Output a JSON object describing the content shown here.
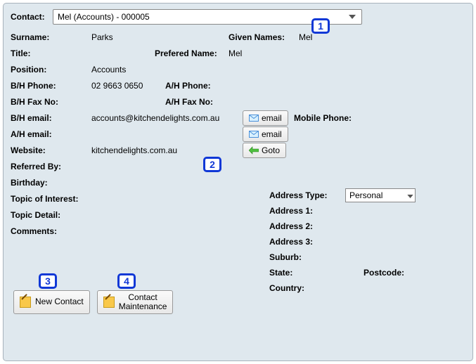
{
  "contact_label": "Contact:",
  "contact_selected": "Mel (Accounts) - 000005",
  "badges": {
    "b1": "1",
    "b2": "2",
    "b3": "3",
    "b4": "4"
  },
  "surname": {
    "label": "Surname:",
    "value": "Parks"
  },
  "given_names": {
    "label": "Given Names:",
    "value": "Mel"
  },
  "title": {
    "label": "Title:",
    "value": ""
  },
  "prefered_name": {
    "label": "Prefered Name:",
    "value": "Mel"
  },
  "position": {
    "label": "Position:",
    "value": "Accounts"
  },
  "bh_phone": {
    "label": "B/H Phone:",
    "value": "02 9663 0650"
  },
  "ah_phone": {
    "label": "A/H Phone:",
    "value": ""
  },
  "bh_fax": {
    "label": "B/H Fax No:",
    "value": ""
  },
  "ah_fax": {
    "label": "A/H Fax No:",
    "value": ""
  },
  "bh_email": {
    "label": "B/H email:",
    "value": "accounts@kitchendelights.com.au"
  },
  "ah_email": {
    "label": "A/H email:",
    "value": ""
  },
  "website": {
    "label": "Website:",
    "value": "kitchendelights.com.au"
  },
  "mobile_phone": {
    "label": "Mobile Phone:",
    "value": ""
  },
  "referred_by": {
    "label": "Referred By:",
    "value": ""
  },
  "birthday": {
    "label": "Birthday:",
    "value": ""
  },
  "topic_interest": {
    "label": "Topic of Interest:",
    "value": ""
  },
  "topic_detail": {
    "label": "Topic Detail:",
    "value": ""
  },
  "comments": {
    "label": "Comments:",
    "value": ""
  },
  "buttons": {
    "email": "email",
    "goto": "Goto",
    "new_contact": "New Contact",
    "contact_maintenance": "Contact\nMaintenance"
  },
  "address": {
    "type_label": "Address Type:",
    "type_value": "Personal",
    "addr1": "Address 1:",
    "addr2": "Address 2:",
    "addr3": "Address 3:",
    "suburb": "Suburb:",
    "state": "State:",
    "postcode": "Postcode:",
    "country": "Country:"
  }
}
